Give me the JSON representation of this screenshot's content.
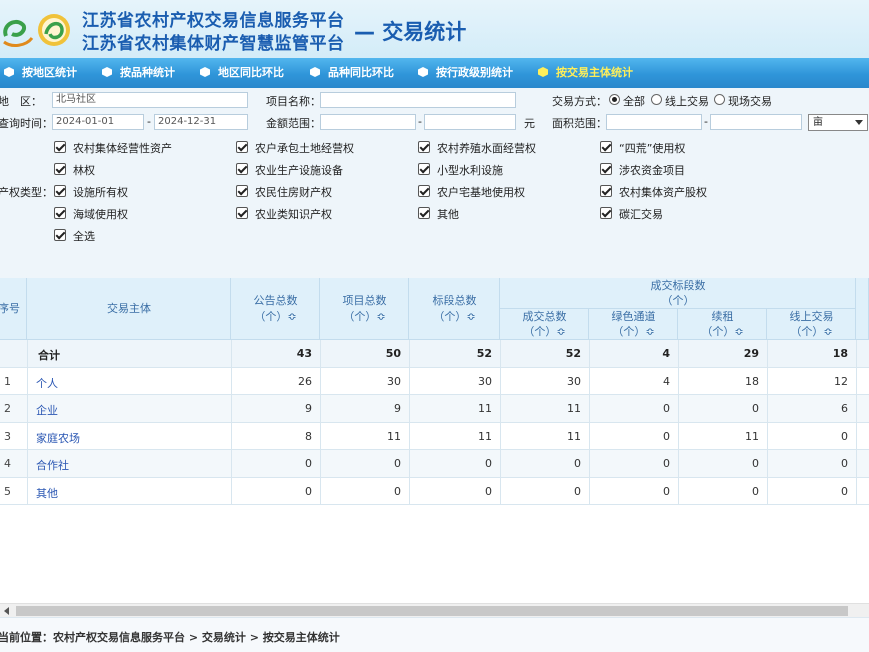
{
  "header": {
    "title_line1": "江苏省农村产权交易信息服务平台",
    "title_line2": "江苏省农村集体财产智慧监管平台",
    "title_suffix": "— 交易统计"
  },
  "nav": {
    "items": [
      {
        "label": "按地区统计",
        "active": false
      },
      {
        "label": "按品种统计",
        "active": false
      },
      {
        "label": "地区同比环比",
        "active": false
      },
      {
        "label": "品种同比环比",
        "active": false
      },
      {
        "label": "按行政级别统计",
        "active": false
      },
      {
        "label": "按交易主体统计",
        "active": true
      }
    ]
  },
  "filters": {
    "region_label": "地　区：",
    "region_value": "北马社区",
    "project_name_label": "项目名称：",
    "project_name_value": "",
    "trade_mode_label": "交易方式：",
    "trade_mode_options": [
      "全部",
      "线上交易",
      "现场交易"
    ],
    "trade_mode_selected": "全部",
    "query_time_label": "查询时间：",
    "date_from": "2024-01-01",
    "date_sep": "-",
    "date_to": "2024-12-31",
    "amount_label": "金额范围：",
    "amount_sep": "-",
    "amount_unit": "元",
    "area_label": "面积范围：",
    "area_sep": "-",
    "area_unit_selected": "亩",
    "property_type_label": "产权类型：",
    "property_types": [
      [
        "农村集体经营性资产",
        "农户承包土地经营权",
        "农村养殖水面经营权",
        "“四荒”使用权"
      ],
      [
        "林权",
        "农业生产设施设备",
        "小型水利设施",
        "涉农资金项目"
      ],
      [
        "设施所有权",
        "农民住房财产权",
        "农户宅基地使用权",
        "农村集体资产股权"
      ],
      [
        "海域使用权",
        "农业类知识产权",
        "其他",
        "碳汇交易"
      ],
      [
        "全选"
      ]
    ]
  },
  "table": {
    "headers": {
      "seq": "序号",
      "subject": "交易主体",
      "announce_total": "公告总数",
      "announce_unit": "（个）≎",
      "project_total": "项目总数",
      "project_unit": "（个）≎",
      "section_total": "标段总数",
      "section_unit": "（个）≎",
      "deal_group": "成交标段数",
      "deal_group_unit": "（个）",
      "deal_total": "成交总数",
      "deal_total_unit": "（个）≎",
      "green": "绿色通道",
      "green_unit": "（个）≎",
      "renew": "续租",
      "renew_unit": "（个）≎",
      "online": "线上交易",
      "online_unit": "（个）≎"
    },
    "total_row": {
      "label": "合计",
      "values": [
        "43",
        "50",
        "52",
        "52",
        "4",
        "29",
        "18"
      ]
    },
    "rows": [
      {
        "seq": "1",
        "subject": "个人",
        "values": [
          "26",
          "30",
          "30",
          "30",
          "4",
          "18",
          "12"
        ]
      },
      {
        "seq": "2",
        "subject": "企业",
        "values": [
          "9",
          "9",
          "11",
          "11",
          "0",
          "0",
          "6"
        ]
      },
      {
        "seq": "3",
        "subject": "家庭农场",
        "values": [
          "8",
          "11",
          "11",
          "11",
          "0",
          "11",
          "0"
        ]
      },
      {
        "seq": "4",
        "subject": "合作社",
        "values": [
          "0",
          "0",
          "0",
          "0",
          "0",
          "0",
          "0"
        ]
      },
      {
        "seq": "5",
        "subject": "其他",
        "values": [
          "0",
          "0",
          "0",
          "0",
          "0",
          "0",
          "0"
        ]
      }
    ]
  },
  "breadcrumb": {
    "text": "当前位置：农村产权交易信息服务平台 > 交易统计 > 按交易主体统计"
  },
  "colors": {
    "brand": "#1a5db0",
    "nav_bg": "#3a9fe0",
    "nav_active": "#ffef5a",
    "header_cell": "#dff0fa",
    "link": "#2b57b3"
  }
}
